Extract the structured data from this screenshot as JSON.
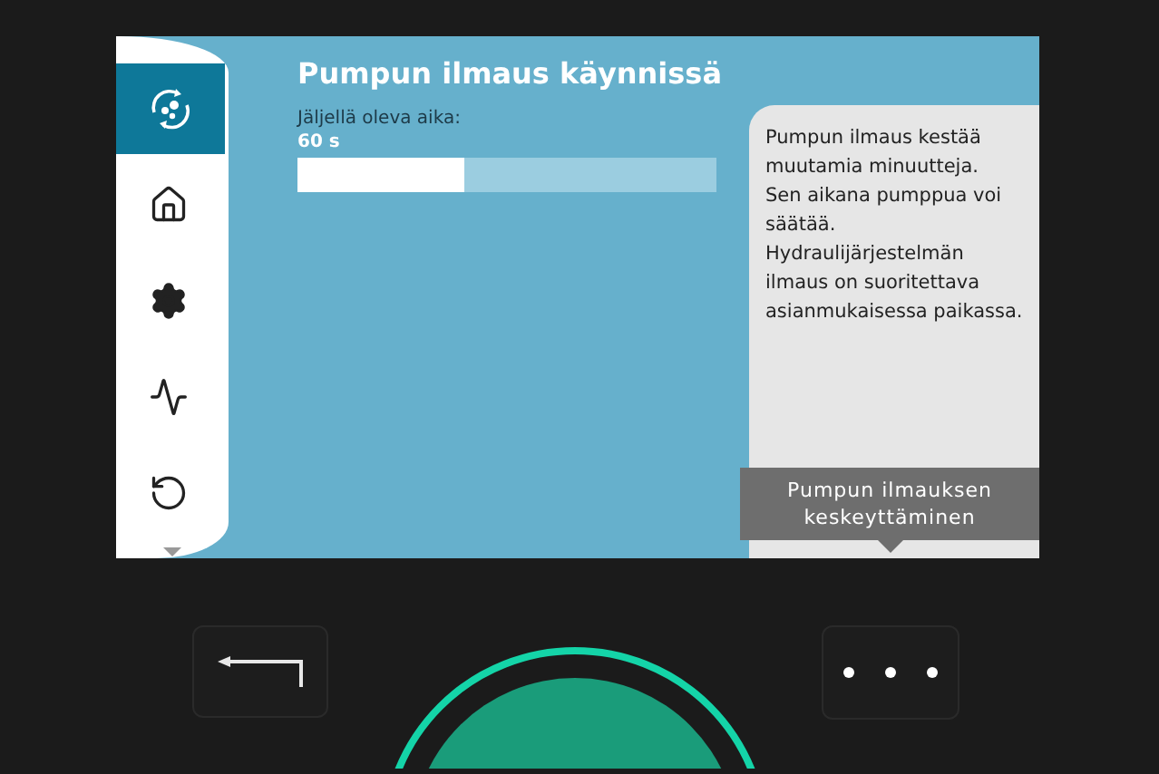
{
  "sidebar": {
    "items": [
      {
        "kind": "venting",
        "selected": true
      },
      {
        "kind": "home",
        "selected": false
      },
      {
        "kind": "settings",
        "selected": false
      },
      {
        "kind": "diagnostics",
        "selected": false
      },
      {
        "kind": "restore",
        "selected": false
      }
    ]
  },
  "title": "Pumpun ilmaus käynnissä",
  "remaining": {
    "label": "Jäljellä oleva aika:",
    "value": "60 s",
    "level": 0.4
  },
  "info": {
    "paragraphs": [
      "Pumpun ilmaus kestää muutamia minuutteja.",
      "Sen aikana pumppua voi säätää.",
      "Hydraulijärjestelmän ilmaus on suoritettava asianmukaisessa paikassa."
    ]
  },
  "action_button": {
    "label": "Pumpun ilmauksen keskeyttäminen"
  }
}
